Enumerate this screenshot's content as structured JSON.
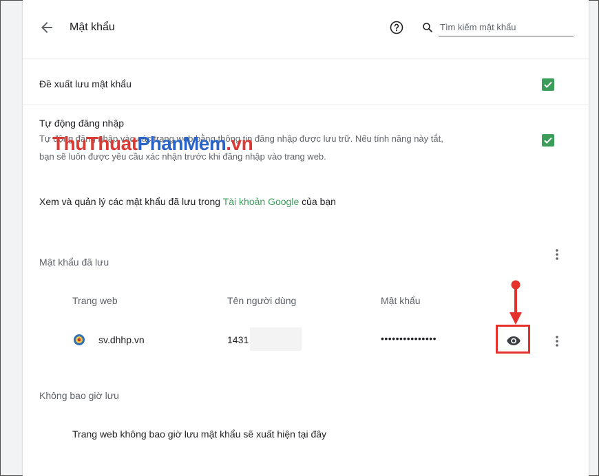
{
  "header": {
    "title": "Mật khẩu",
    "search_placeholder": "Tìm kiếm mật khẩu"
  },
  "settings": {
    "offer_to_save": {
      "label": "Đề xuất lưu mật khẩu",
      "checked": true
    },
    "auto_signin": {
      "label": "Tự động đăng nhập",
      "description_line1": "Tự động đăng nhập vào các trang web bằng thông tin đăng nhập được lưu trữ. Nếu tính năng này tắt,",
      "description_line2": "bạn sẽ luôn được yêu cầu xác nhận trước khi đăng nhập vào trang web.",
      "checked": true
    },
    "manage_prefix": "Xem và quản lý các mật khẩu đã lưu trong ",
    "manage_link": "Tài khoản Google",
    "manage_suffix": " của bạn"
  },
  "saved_passwords": {
    "title": "Mật khẩu đã lưu",
    "columns": {
      "website": "Trang web",
      "username": "Tên người dùng",
      "password": "Mật khẩu"
    },
    "rows": [
      {
        "website": "sv.dhhp.vn",
        "username": "1431",
        "password": "•••••••••••••••"
      }
    ]
  },
  "never_saved": {
    "title": "Không bao giờ lưu",
    "empty_text": "Trang web không bao giờ lưu mật khẩu sẽ xuất hiện tại đây"
  },
  "watermark": {
    "part1": "ThuThuat",
    "part2": "PhanMem",
    "part3": ".vn"
  },
  "colors": {
    "accent_green": "#3c9c5a",
    "annotation_red": "#e5312b"
  },
  "icons": [
    "back-arrow-icon",
    "help-icon",
    "search-icon",
    "more-vert-icon",
    "eye-icon",
    "favicon-icon"
  ]
}
